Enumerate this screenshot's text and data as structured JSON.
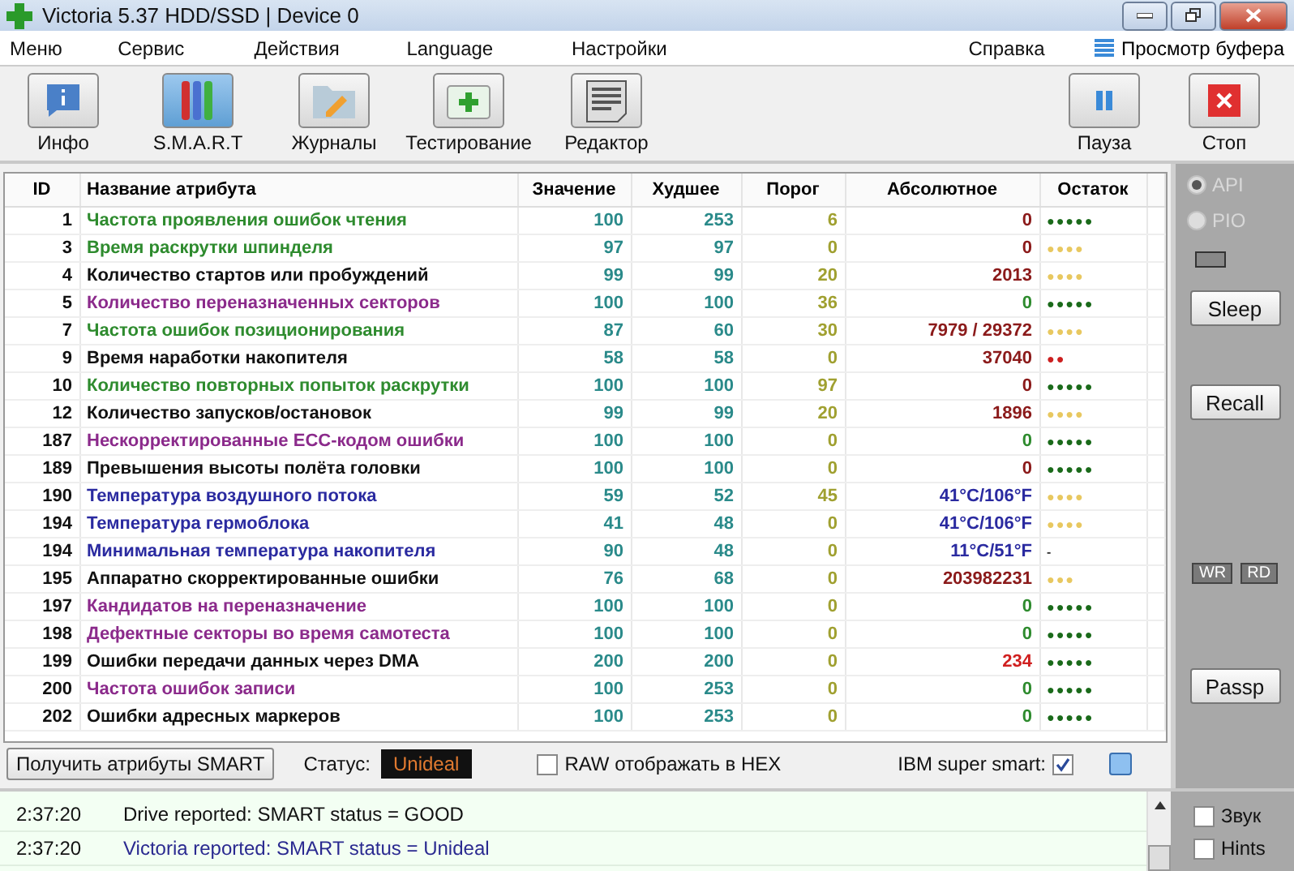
{
  "window": {
    "title": "Victoria 5.37 HDD/SSD | Device 0"
  },
  "menu": [
    {
      "label": "Меню"
    },
    {
      "label": "Сервис"
    },
    {
      "label": "Действия"
    },
    {
      "label": "Language"
    },
    {
      "label": "Настройки"
    },
    {
      "label": "Справка"
    }
  ],
  "buffer_view": {
    "label": "Просмотр буфера"
  },
  "toolbar": [
    {
      "label": "Инфо",
      "selected": false
    },
    {
      "label": "S.M.A.R.T",
      "selected": true
    },
    {
      "label": "Журналы",
      "selected": false
    },
    {
      "label": "Тестирование",
      "selected": false
    },
    {
      "label": "Редактор",
      "selected": false
    }
  ],
  "toolbar_right": [
    {
      "label": "Пауза"
    },
    {
      "label": "Стоп"
    }
  ],
  "table": {
    "columns": [
      "ID",
      "Название атрибута",
      "Значение",
      "Худшее",
      "Порог",
      "Абсолютное",
      "Остаток"
    ],
    "rows": [
      {
        "id": "1",
        "name": {
          "text": "Частота проявления ошибок чтения",
          "color": "#2e8b2e"
        },
        "value": "100",
        "worst": "253",
        "threshold": "6",
        "raw": {
          "text": "0",
          "color": "#8b1a1a"
        },
        "remain": {
          "text": "●●●●●",
          "color": "#1a6a1a"
        }
      },
      {
        "id": "3",
        "name": {
          "text": "Время раскрутки шпинделя",
          "color": "#2e8b2e"
        },
        "value": "97",
        "worst": "97",
        "threshold": "0",
        "raw": {
          "text": "0",
          "color": "#8b1a1a"
        },
        "remain": {
          "text": "●●●●",
          "color": "#e8c860"
        }
      },
      {
        "id": "4",
        "name": {
          "text": "Количество стартов или пробуждений",
          "color": "#111111"
        },
        "value": "99",
        "worst": "99",
        "threshold": "20",
        "raw": {
          "text": "2013",
          "color": "#8b1a1a"
        },
        "remain": {
          "text": "●●●●",
          "color": "#e8c860"
        }
      },
      {
        "id": "5",
        "name": {
          "text": "Количество переназначенных секторов",
          "color": "#8b2a8b"
        },
        "value": "100",
        "worst": "100",
        "threshold": "36",
        "raw": {
          "text": "0",
          "color": "#2e8b2e"
        },
        "remain": {
          "text": "●●●●●",
          "color": "#1a6a1a"
        }
      },
      {
        "id": "7",
        "name": {
          "text": "Частота ошибок позиционирования",
          "color": "#2e8b2e"
        },
        "value": "87",
        "worst": "60",
        "threshold": "30",
        "raw": {
          "text": "7979 / 29372",
          "color": "#8b1a1a"
        },
        "remain": {
          "text": "●●●●",
          "color": "#e8c860"
        }
      },
      {
        "id": "9",
        "name": {
          "text": "Время наработки накопителя",
          "color": "#111111"
        },
        "value": "58",
        "worst": "58",
        "threshold": "0",
        "raw": {
          "text": "37040",
          "color": "#8b1a1a"
        },
        "remain": {
          "text": "●●",
          "color": "#cc2020"
        }
      },
      {
        "id": "10",
        "name": {
          "text": "Количество повторных попыток раскрутки",
          "color": "#2e8b2e"
        },
        "value": "100",
        "worst": "100",
        "threshold": "97",
        "raw": {
          "text": "0",
          "color": "#8b1a1a"
        },
        "remain": {
          "text": "●●●●●",
          "color": "#1a6a1a"
        }
      },
      {
        "id": "12",
        "name": {
          "text": "Количество запусков/остановок",
          "color": "#111111"
        },
        "value": "99",
        "worst": "99",
        "threshold": "20",
        "raw": {
          "text": "1896",
          "color": "#8b1a1a"
        },
        "remain": {
          "text": "●●●●",
          "color": "#e8c860"
        }
      },
      {
        "id": "187",
        "name": {
          "text": "Нескорректированные ECC-кодом ошибки",
          "color": "#8b2a8b"
        },
        "value": "100",
        "worst": "100",
        "threshold": "0",
        "raw": {
          "text": "0",
          "color": "#2e8b2e"
        },
        "remain": {
          "text": "●●●●●",
          "color": "#1a6a1a"
        }
      },
      {
        "id": "189",
        "name": {
          "text": "Превышения высоты полёта головки",
          "color": "#111111"
        },
        "value": "100",
        "worst": "100",
        "threshold": "0",
        "raw": {
          "text": "0",
          "color": "#8b1a1a"
        },
        "remain": {
          "text": "●●●●●",
          "color": "#1a6a1a"
        }
      },
      {
        "id": "190",
        "name": {
          "text": "Температура воздушного потока",
          "color": "#2a2aa0"
        },
        "value": "59",
        "worst": "52",
        "threshold": "45",
        "raw": {
          "text": "41°C/106°F",
          "color": "#2a2aa0"
        },
        "remain": {
          "text": "●●●●",
          "color": "#e8c860"
        }
      },
      {
        "id": "194",
        "name": {
          "text": "Температура гермоблока",
          "color": "#2a2aa0"
        },
        "value": "41",
        "worst": "48",
        "threshold": "0",
        "raw": {
          "text": "41°C/106°F",
          "color": "#2a2aa0"
        },
        "remain": {
          "text": "●●●●",
          "color": "#e8c860"
        }
      },
      {
        "id": "194",
        "name": {
          "text": "Минимальная температура накопителя",
          "color": "#2a2aa0"
        },
        "value": "90",
        "worst": "48",
        "threshold": "0",
        "raw": {
          "text": "11°C/51°F",
          "color": "#2a2aa0"
        },
        "remain": {
          "text": "-",
          "color": "#333333"
        }
      },
      {
        "id": "195",
        "name": {
          "text": "Аппаратно скорректированные ошибки",
          "color": "#111111"
        },
        "value": "76",
        "worst": "68",
        "threshold": "0",
        "raw": {
          "text": "203982231",
          "color": "#8b1a1a"
        },
        "remain": {
          "text": "●●●",
          "color": "#e8c860"
        }
      },
      {
        "id": "197",
        "name": {
          "text": "Кандидатов на переназначение",
          "color": "#8b2a8b"
        },
        "value": "100",
        "worst": "100",
        "threshold": "0",
        "raw": {
          "text": "0",
          "color": "#2e8b2e"
        },
        "remain": {
          "text": "●●●●●",
          "color": "#1a6a1a"
        }
      },
      {
        "id": "198",
        "name": {
          "text": "Дефектные секторы во время самотеста",
          "color": "#8b2a8b"
        },
        "value": "100",
        "worst": "100",
        "threshold": "0",
        "raw": {
          "text": "0",
          "color": "#2e8b2e"
        },
        "remain": {
          "text": "●●●●●",
          "color": "#1a6a1a"
        }
      },
      {
        "id": "199",
        "name": {
          "text": "Ошибки передачи данных через DMA",
          "color": "#111111"
        },
        "value": "200",
        "worst": "200",
        "threshold": "0",
        "raw": {
          "text": "234",
          "color": "#d02020"
        },
        "remain": {
          "text": "●●●●●",
          "color": "#1a6a1a"
        }
      },
      {
        "id": "200",
        "name": {
          "text": "Частота ошибок записи",
          "color": "#8b2a8b"
        },
        "value": "100",
        "worst": "253",
        "threshold": "0",
        "raw": {
          "text": "0",
          "color": "#2e8b2e"
        },
        "remain": {
          "text": "●●●●●",
          "color": "#1a6a1a"
        }
      },
      {
        "id": "202",
        "name": {
          "text": "Ошибки адресных маркеров",
          "color": "#111111"
        },
        "value": "100",
        "worst": "253",
        "threshold": "0",
        "raw": {
          "text": "0",
          "color": "#2e8b2e"
        },
        "remain": {
          "text": "●●●●●",
          "color": "#1a6a1a"
        }
      }
    ]
  },
  "side_panel": {
    "modes": [
      {
        "label": "API",
        "selected": true
      },
      {
        "label": "PIO",
        "selected": false
      }
    ],
    "buttons": [
      {
        "label": "Sleep"
      },
      {
        "label": "Recall"
      }
    ],
    "indicators": [
      {
        "label": "WR"
      },
      {
        "label": "RD"
      }
    ],
    "passp": {
      "label": "Passp"
    }
  },
  "bottom_bar": {
    "get_button": "Получить атрибуты SMART",
    "status_label": "Статус:",
    "status_value": "Unideal",
    "raw_hex": {
      "label": "RAW отображать в HEX",
      "checked": false
    },
    "ibm": {
      "label": "IBM super smart:",
      "checked": true
    }
  },
  "log": [
    {
      "time": "2:37:20",
      "message": {
        "text": "Drive reported: SMART status = GOOD",
        "color": "#111111"
      }
    },
    {
      "time": "2:37:20",
      "message": {
        "text": "Victoria reported: SMART status = Unideal",
        "color": "#2a2a90"
      }
    }
  ],
  "options": [
    {
      "label": "Звук",
      "checked": false
    },
    {
      "label": "Hints",
      "checked": false
    }
  ]
}
